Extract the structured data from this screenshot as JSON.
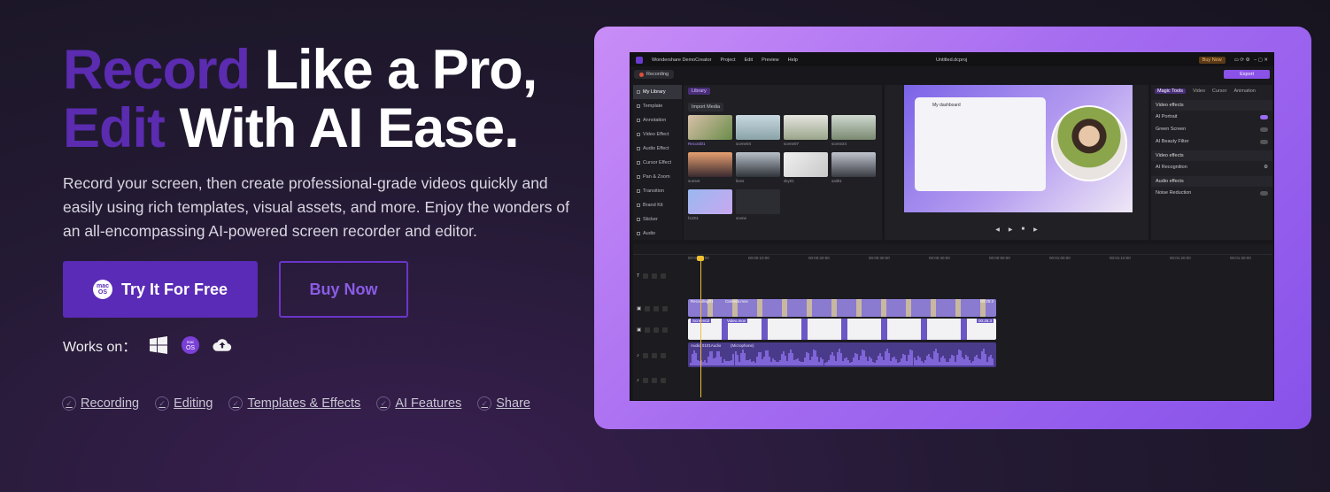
{
  "hero": {
    "line1_accent": "Record",
    "line1_rest": " Like a Pro,",
    "line2_accent": "Edit",
    "line2_rest": " With AI Ease.",
    "subtitle": "Record your screen, then create professional-grade videos quickly and easily using rich templates, visual assets, and more. Enjoy the wonders of an all-encompassing AI-powered screen recorder and editor."
  },
  "cta": {
    "primary_label": "Try It For Free",
    "primary_badge": "macOS",
    "secondary_label": "Buy Now"
  },
  "works_on": {
    "label": "Works on：",
    "platforms": [
      "windows-icon",
      "macos-icon",
      "cloud-upload-icon"
    ]
  },
  "features": [
    "Recording",
    "Editing",
    "Templates & Effects",
    "AI Features",
    "Share"
  ],
  "colors": {
    "accent": "#5a2bb6",
    "headline_accent": "#5b2bb0",
    "showcase_gradient_start": "#c98df7",
    "showcase_gradient_end": "#8852ea"
  },
  "app": {
    "name": "Wondershare DemoCreator",
    "menu": [
      "Project",
      "Edit",
      "Preview",
      "Help"
    ],
    "file_title": "Untitled.dcproj",
    "buy_label": "Buy Now",
    "recording_label": "Recording",
    "export_label": "Export",
    "sidebar": [
      "My Library",
      "Template",
      "Annotation",
      "Video Effect",
      "Audio Effect",
      "Cursor Effect",
      "Pan & Zoom",
      "Transition",
      "Brand Kit",
      "Sticker",
      "Audio"
    ],
    "library_tab": "Library",
    "import_label": "Import Media",
    "media_names": [
      "Record01",
      "scene04",
      "scene07",
      "scene24",
      "sunset",
      "lines",
      "sky01",
      "sail01",
      "fxi201",
      "scene"
    ],
    "preview_title": "My dashboard",
    "props_tabs": [
      "Magic Tools",
      "Video",
      "Cursor",
      "Animation"
    ],
    "props_sections": [
      {
        "head": "Video effects",
        "rows": [
          "AI Portrait",
          "Green Screen",
          "AI Beauty Filter"
        ]
      },
      {
        "head": "Video effects",
        "rows": [
          "AI Recognition"
        ]
      },
      {
        "head": "Audio effects",
        "rows": [
          "Noise Reduction"
        ]
      }
    ],
    "ruler_marks": [
      "00:00:00:00",
      "00:00:10:00",
      "00:00:20:00",
      "00:00:30:00",
      "00:00:40:00",
      "00:00:50:00",
      "00:01:00:00",
      "00:01:10:00",
      "00:01:20:00",
      "00:01:30:00"
    ],
    "clips": [
      {
        "label": "Recording01",
        "sub": "Camera.mov",
        "time": "00:25:3"
      },
      {
        "label": "Screen02",
        "sub": "Video.mov",
        "time": "00:25:3"
      },
      {
        "label": "Audio 0101Audio",
        "sub": "(Microphone)",
        "time": ""
      }
    ]
  }
}
